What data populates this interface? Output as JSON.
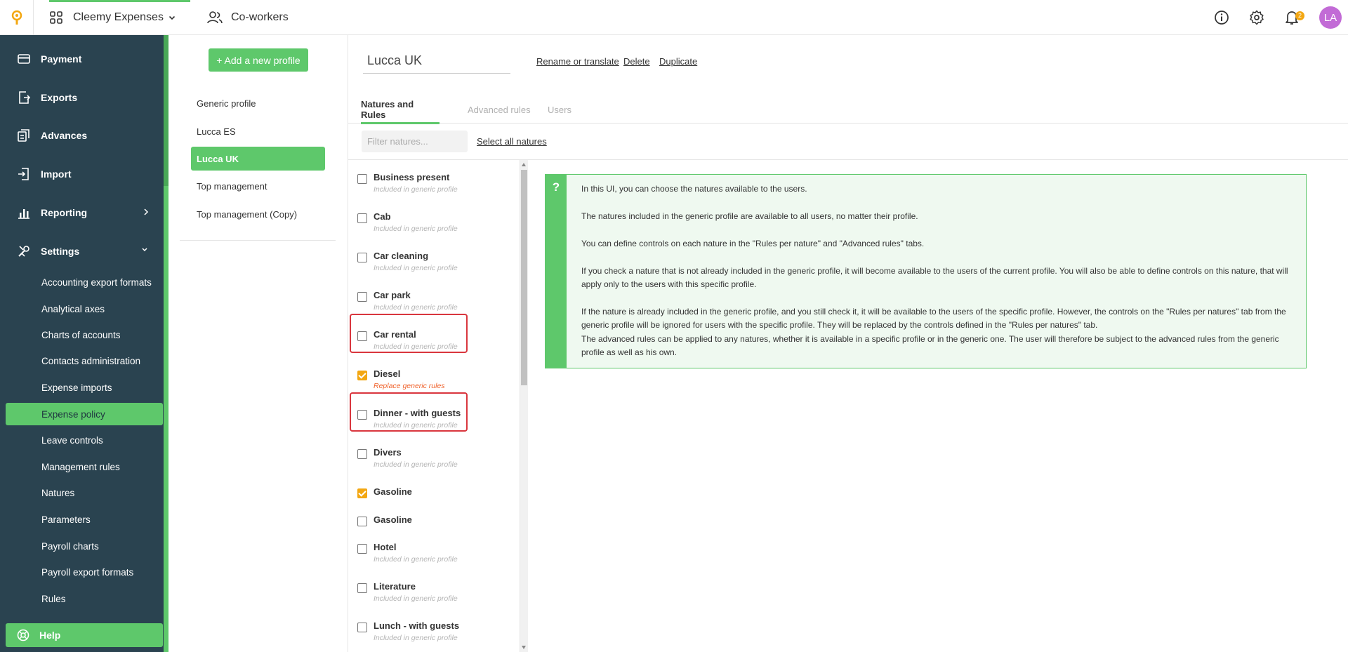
{
  "header": {
    "app_name": "Cleemy Expenses",
    "coworkers_label": "Co-workers",
    "notification_count": "2",
    "avatar_initials": "LA"
  },
  "sidebar": {
    "items": [
      {
        "label": "Payment",
        "icon": "card-icon"
      },
      {
        "label": "Exports",
        "icon": "export-icon"
      },
      {
        "label": "Advances",
        "icon": "advance-icon"
      },
      {
        "label": "Import",
        "icon": "import-icon"
      },
      {
        "label": "Reporting",
        "icon": "chart-icon"
      },
      {
        "label": "Settings",
        "icon": "tools-icon"
      }
    ],
    "settings_items": [
      "Accounting export formats",
      "Analytical axes",
      "Charts of accounts",
      "Contacts administration",
      "Expense imports",
      "Expense policy",
      "Leave controls",
      "Management rules",
      "Natures",
      "Parameters",
      "Payroll charts",
      "Payroll export formats",
      "Rules"
    ],
    "active_settings_item": "Expense policy",
    "help_label": "Help"
  },
  "profiles": {
    "add_label": "+ Add a new profile",
    "items": [
      "Generic profile",
      "Lucca ES",
      "Lucca UK",
      "Top management",
      "Top management (Copy)"
    ],
    "active": "Lucca UK"
  },
  "main": {
    "profile_name": "Lucca UK",
    "actions": {
      "rename": "Rename or translate",
      "delete": "Delete",
      "duplicate": "Duplicate"
    },
    "tabs": [
      "Natures and Rules",
      "Advanced rules",
      "Users"
    ],
    "active_tab": "Natures and Rules",
    "filter_placeholder": "Filter natures...",
    "select_all_label": "Select all natures"
  },
  "natures": [
    {
      "label": "Business present",
      "sub": "Included in generic profile",
      "checked": false
    },
    {
      "label": "Cab",
      "sub": "Included in generic profile",
      "checked": false
    },
    {
      "label": "Car cleaning",
      "sub": "Included in generic profile",
      "checked": false
    },
    {
      "label": "Car park",
      "sub": "Included in generic profile",
      "checked": false,
      "highlighted": true
    },
    {
      "label": "Car rental",
      "sub": "Included in generic profile",
      "checked": false
    },
    {
      "label": "Diesel",
      "sub": "Replace generic rules",
      "checked": true,
      "highlighted": true
    },
    {
      "label": "Dinner - with guests",
      "sub": "Included in generic profile",
      "checked": false
    },
    {
      "label": "Divers",
      "sub": "Included in generic profile",
      "checked": false
    },
    {
      "label": "Gasoline",
      "sub": "",
      "checked": true
    },
    {
      "label": "Gasoline",
      "sub": "",
      "checked": false
    },
    {
      "label": "Hotel",
      "sub": "Included in generic profile",
      "checked": false
    },
    {
      "label": "Literature",
      "sub": "Included in generic profile",
      "checked": false
    },
    {
      "label": "Lunch - with guests",
      "sub": "Included in generic profile",
      "checked": false
    }
  ],
  "info": {
    "icon_label": "?",
    "paragraphs": [
      "In this UI, you can choose the natures available to the users.",
      "The natures included in the generic profile are available to all users, no matter their profile.",
      "You can define controls on each nature in the \"Rules per nature\" and \"Advanced rules\" tabs.",
      "If you check a nature that is not already included in the generic profile, it will become available to the users of the current profile. You will also be able to define controls on this nature, that will apply only to the users with this specific profile.",
      "If the nature is already included in the generic profile, and you still check it, it will be available to the users of the specific profile. However, the controls on the \"Rules per natures\" tab from the generic profile will be ignored for users with the specific profile. They will be replaced by the controls defined in the \"Rules per natures\" tab.",
      "The advanced rules can be applied to any natures, whether it is available in a specific profile or in the generic one. The user will therefore be subject to the advanced rules from the generic profile as well as his own."
    ]
  },
  "colors": {
    "accent_green": "#5ec86b",
    "sidebar_bg": "#2a4350",
    "checkbox_checked": "#f3a712",
    "highlight_border": "#d9363e",
    "warn_text": "#f0642e",
    "avatar_bg": "#c26bd6"
  }
}
